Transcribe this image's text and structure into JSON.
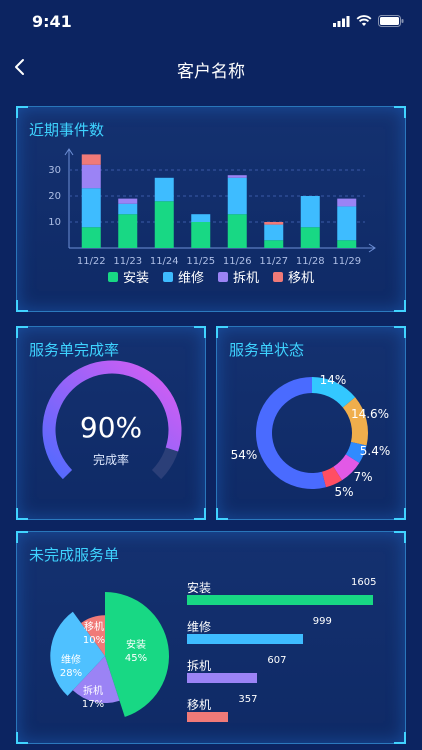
{
  "status": {
    "time": "9:41"
  },
  "nav": {
    "title": "客户名称"
  },
  "recent_events": {
    "title": "近期事件数",
    "legend": [
      {
        "label": "安装",
        "color": "#18d884"
      },
      {
        "label": "维修",
        "color": "#3ebcff"
      },
      {
        "label": "拆机",
        "color": "#9b83f5"
      },
      {
        "label": "移机",
        "color": "#f07a78"
      }
    ]
  },
  "completion": {
    "title": "服务单完成率",
    "value_text": "90%",
    "label": "完成率",
    "value": 0.9
  },
  "status_card": {
    "title": "服务单状态"
  },
  "unfinished": {
    "title": "未完成服务单",
    "items": [
      {
        "label": "安装",
        "value": 1605,
        "value_text": "1605",
        "color": "#18d884"
      },
      {
        "label": "维修",
        "value": 999,
        "value_text": "999",
        "color": "#3ebcff"
      },
      {
        "label": "拆机",
        "value": 607,
        "value_text": "607",
        "color": "#9b83f5"
      },
      {
        "label": "移机",
        "value": 357,
        "value_text": "357",
        "color": "#f07a78"
      }
    ]
  },
  "chart_data": [
    {
      "type": "bar",
      "stacked": true,
      "title": "近期事件数",
      "categories": [
        "11/22",
        "11/23",
        "11/24",
        "11/25",
        "11/26",
        "11/27",
        "11/28",
        "11/29"
      ],
      "series": [
        {
          "name": "安装",
          "color": "#18d884",
          "values": [
            8,
            13,
            18,
            10,
            13,
            3,
            8,
            3
          ]
        },
        {
          "name": "维修",
          "color": "#3ebcff",
          "values": [
            15,
            4,
            9,
            3,
            14,
            6,
            12,
            13
          ]
        },
        {
          "name": "拆机",
          "color": "#9b83f5",
          "values": [
            9,
            2,
            0,
            0,
            1,
            0,
            0,
            3
          ]
        },
        {
          "name": "移机",
          "color": "#f07a78",
          "values": [
            4,
            0,
            0,
            0,
            0,
            1,
            0,
            0
          ]
        }
      ],
      "y_ticks": [
        "10",
        "20",
        "30"
      ],
      "ylim": [
        0,
        35
      ],
      "grid": true
    },
    {
      "type": "pie",
      "title": "服务单状态",
      "donut": true,
      "slices": [
        {
          "label": "14%",
          "value": 14,
          "color": "#33c8ff"
        },
        {
          "label": "14.6%",
          "value": 14.6,
          "color": "#f0ae4c"
        },
        {
          "label": "5.4%",
          "value": 5.4,
          "color": "#2f8bff"
        },
        {
          "label": "7%",
          "value": 7,
          "color": "#e259e6"
        },
        {
          "label": "5%",
          "value": 5,
          "color": "#ff4e63"
        },
        {
          "label": "54%",
          "value": 54,
          "color": "#4a6bff"
        }
      ]
    },
    {
      "type": "pie",
      "title": "未完成服务单",
      "rose": true,
      "slices": [
        {
          "name": "安装",
          "label": "45%",
          "value": 45,
          "color": "#18d884"
        },
        {
          "name": "拆机",
          "label": "17%",
          "value": 17,
          "color": "#9b83f5"
        },
        {
          "name": "维修",
          "label": "28%",
          "value": 28,
          "color": "#4fc1ff"
        },
        {
          "name": "移机",
          "label": "10%",
          "value": 10,
          "color": "#f07a78"
        }
      ]
    }
  ]
}
